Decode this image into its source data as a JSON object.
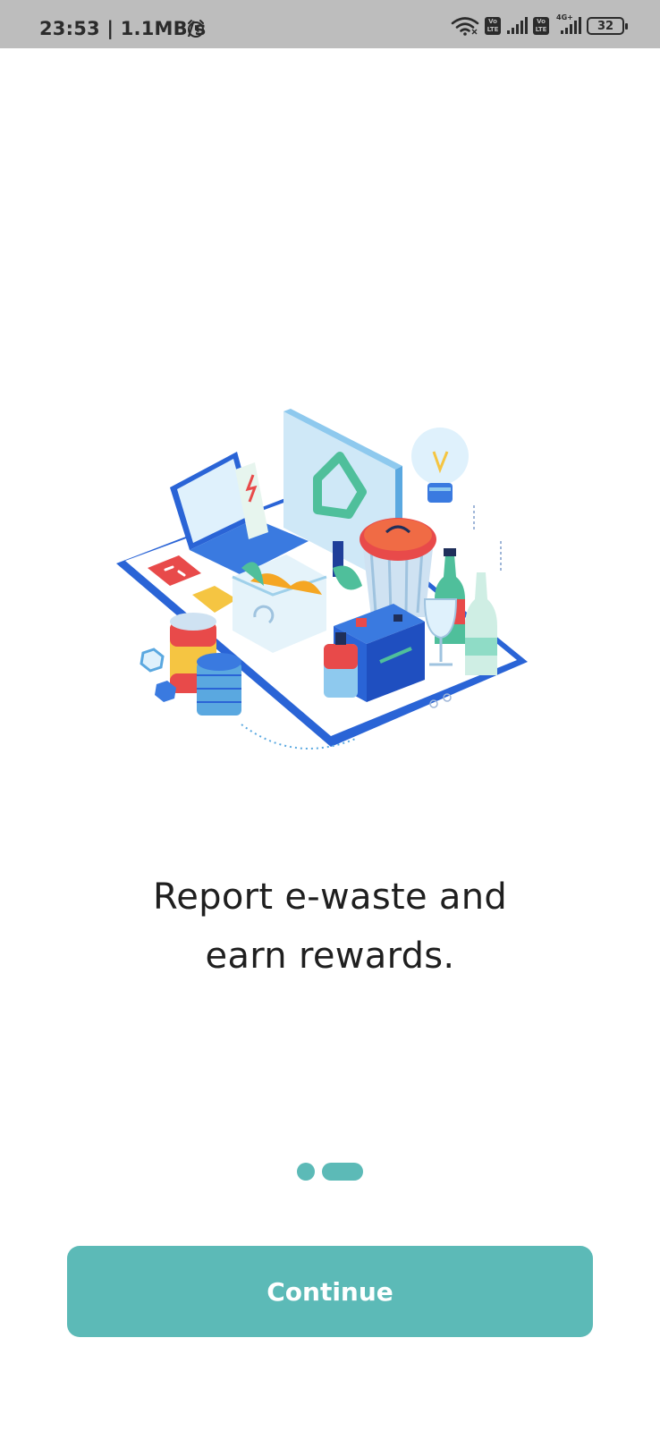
{
  "status_bar": {
    "time": "23:53 | 1.1MB/s",
    "sim1_badge": "Vo LTE",
    "sim2_badge": "Vo LTE",
    "network_type": "4G+",
    "battery": "32",
    "icons": [
      "alarm-icon",
      "wifi-icon",
      "signal-icon",
      "battery-icon"
    ]
  },
  "onboarding": {
    "headline_line1": "Report e-waste and",
    "headline_line2": "earn rewards.",
    "page_count": 2,
    "active_page": 2,
    "continue_label": "Continue"
  },
  "colors": {
    "accent": "#5cbab7",
    "status_bar_bg": "#bdbdbd",
    "text": "#1f1f1f"
  }
}
